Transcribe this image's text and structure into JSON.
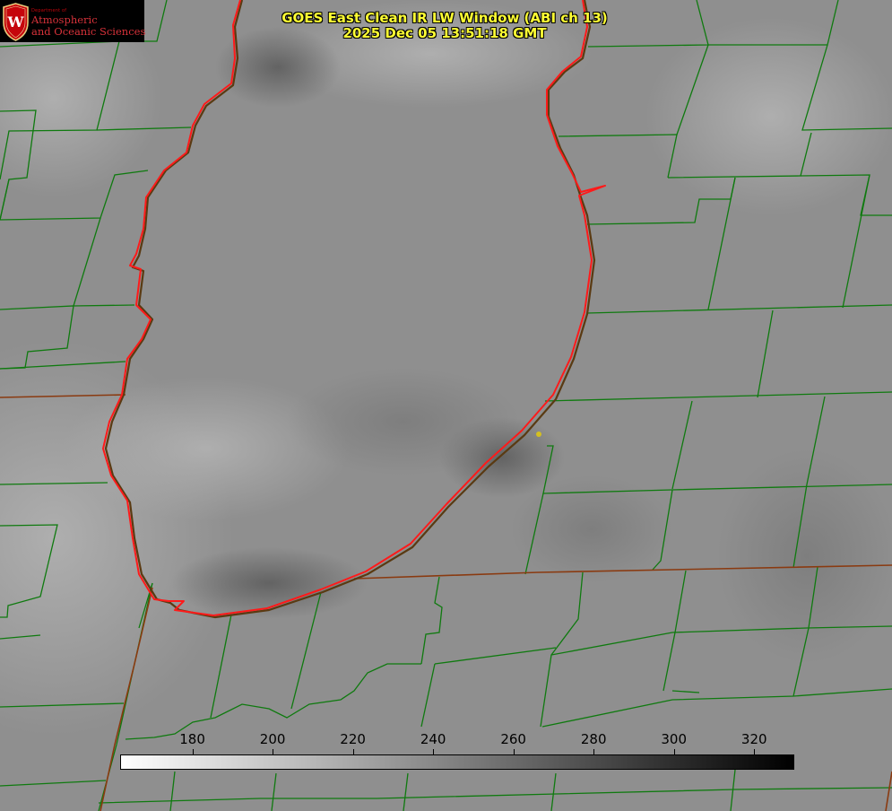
{
  "title": {
    "line1": "GOES East Clean IR LW Window (ABI ch 13)",
    "line2": "2025 Dec 05 13:51:18 GMT"
  },
  "logo": {
    "small_text": "Department of",
    "line1": "Atmospheric",
    "line2": "and Oceanic Sciences",
    "icon": "crest-icon",
    "icon_letter": "W"
  },
  "colorbar": {
    "min": 162,
    "max": 330,
    "ticks": [
      {
        "label": "180",
        "value": 180
      },
      {
        "label": "200",
        "value": 200
      },
      {
        "label": "220",
        "value": 220
      },
      {
        "label": "240",
        "value": 240
      },
      {
        "label": "260",
        "value": 260
      },
      {
        "label": "280",
        "value": 280
      },
      {
        "label": "300",
        "value": 300
      },
      {
        "label": "320",
        "value": 320
      }
    ],
    "gradient_start": "#ffffff",
    "gradient_end": "#000000"
  },
  "colors": {
    "county_borders": "#0f7a0f",
    "state_borders": "#8a3a10",
    "lake_outline": "#ff1a1a",
    "title_text": "#ffff33",
    "marker": "#d4c020"
  },
  "map": {
    "feature": "lake outline",
    "background": "grayscale infrared imagery"
  }
}
